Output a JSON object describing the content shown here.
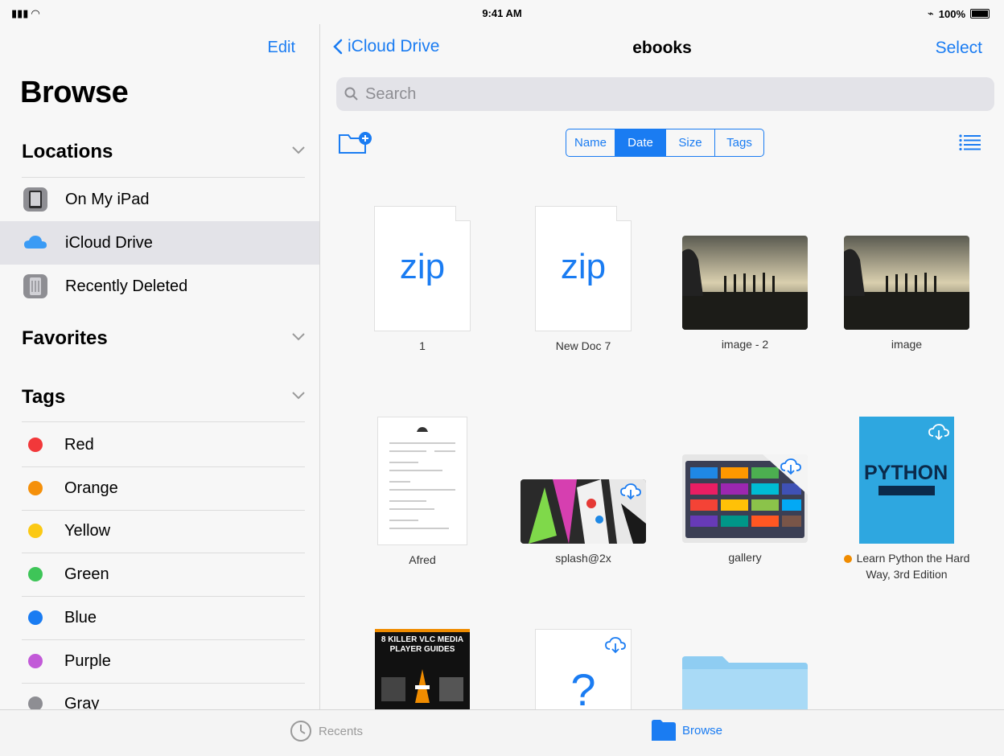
{
  "status_bar": {
    "time": "9:41 AM",
    "battery": "100%"
  },
  "sidebar": {
    "edit_label": "Edit",
    "title": "Browse",
    "locations": {
      "heading": "Locations",
      "items": [
        {
          "label": "On My iPad",
          "icon": "ipad-icon"
        },
        {
          "label": "iCloud Drive",
          "icon": "icloud-icon",
          "selected": true
        },
        {
          "label": "Recently Deleted",
          "icon": "trash-icon"
        }
      ]
    },
    "favorites": {
      "heading": "Favorites"
    },
    "tags": {
      "heading": "Tags",
      "items": [
        {
          "label": "Red",
          "color": "#f2383a"
        },
        {
          "label": "Orange",
          "color": "#f5900a"
        },
        {
          "label": "Yellow",
          "color": "#fbc914"
        },
        {
          "label": "Green",
          "color": "#3ec558"
        },
        {
          "label": "Blue",
          "color": "#1a7cf2"
        },
        {
          "label": "Purple",
          "color": "#c25ad8"
        },
        {
          "label": "Gray",
          "color": "#8e8e93"
        }
      ]
    }
  },
  "main": {
    "back_label": "iCloud Drive",
    "title": "ebooks",
    "select_label": "Select",
    "search_placeholder": "Search",
    "sort_options": [
      "Name",
      "Date",
      "Size",
      "Tags"
    ],
    "sort_selected": "Date",
    "files": [
      {
        "name": "1",
        "kind": "zip",
        "thumb_text": "zip"
      },
      {
        "name": "New Doc 7",
        "kind": "zip",
        "thumb_text": "zip"
      },
      {
        "name": "image - 2",
        "kind": "photo"
      },
      {
        "name": "image",
        "kind": "photo"
      },
      {
        "name": "Afred",
        "kind": "document"
      },
      {
        "name": "splash@2x",
        "kind": "image",
        "cloud": true
      },
      {
        "name": "gallery",
        "kind": "image",
        "cloud": true
      },
      {
        "name": "Learn Python the Hard Way, 3rd Edition",
        "kind": "book",
        "cloud": true,
        "tag_color": "#f08c00",
        "cover_text": "PYTHON"
      },
      {
        "name": "",
        "kind": "book-vlc",
        "cover_text": "8 KILLER VLC MEDIA PLAYER GUIDES"
      },
      {
        "name": "",
        "kind": "unknown",
        "cloud": true,
        "thumb_text": "?"
      },
      {
        "name": "",
        "kind": "folder"
      }
    ]
  },
  "tabbar": {
    "tabs": [
      {
        "label": "Recents",
        "icon": "clock-icon"
      },
      {
        "label": "Browse",
        "icon": "folder-icon",
        "active": true
      }
    ]
  },
  "colors": {
    "accent": "#1a7cf2",
    "sidebar_bg": "#f7f7f7",
    "selected_bg": "#e3e3e8"
  }
}
